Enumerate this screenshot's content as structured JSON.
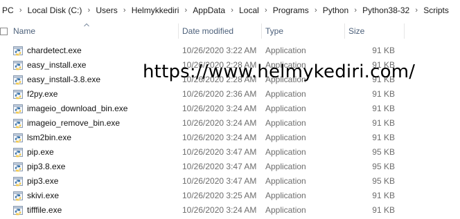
{
  "breadcrumb": [
    "PC",
    "Local Disk (C:)",
    "Users",
    "Helmykkediri",
    "AppData",
    "Local",
    "Programs",
    "Python",
    "Python38-32",
    "Scripts"
  ],
  "columns": {
    "name": "Name",
    "date_modified": "Date modified",
    "type": "Type",
    "size": "Size"
  },
  "files": [
    {
      "name": "chardetect.exe",
      "date": "10/26/2020 3:22 AM",
      "type": "Application",
      "size": "91 KB"
    },
    {
      "name": "easy_install.exe",
      "date": "10/26/2020 2:28 AM",
      "type": "Application",
      "size": "91 KB"
    },
    {
      "name": "easy_install-3.8.exe",
      "date": "10/26/2020 2:28 AM",
      "type": "Application",
      "size": "91 KB"
    },
    {
      "name": "f2py.exe",
      "date": "10/26/2020 2:36 AM",
      "type": "Application",
      "size": "91 KB"
    },
    {
      "name": "imageio_download_bin.exe",
      "date": "10/26/2020 3:24 AM",
      "type": "Application",
      "size": "91 KB"
    },
    {
      "name": "imageio_remove_bin.exe",
      "date": "10/26/2020 3:24 AM",
      "type": "Application",
      "size": "91 KB"
    },
    {
      "name": "lsm2bin.exe",
      "date": "10/26/2020 3:24 AM",
      "type": "Application",
      "size": "91 KB"
    },
    {
      "name": "pip.exe",
      "date": "10/26/2020 3:47 AM",
      "type": "Application",
      "size": "95 KB"
    },
    {
      "name": "pip3.8.exe",
      "date": "10/26/2020 3:47 AM",
      "type": "Application",
      "size": "95 KB"
    },
    {
      "name": "pip3.exe",
      "date": "10/26/2020 3:47 AM",
      "type": "Application",
      "size": "95 KB"
    },
    {
      "name": "skivi.exe",
      "date": "10/26/2020 3:25 AM",
      "type": "Application",
      "size": "91 KB"
    },
    {
      "name": "tifffile.exe",
      "date": "10/26/2020 3:24 AM",
      "type": "Application",
      "size": "91 KB"
    }
  ],
  "icons": {
    "file": "python-exe-icon",
    "sort": "sort-ascending-icon"
  },
  "watermark": "https://www.helmykediri.com/",
  "colors": {
    "header_text": "#4c607a",
    "meta_text": "#6d6d6d",
    "name_text": "#111111"
  }
}
